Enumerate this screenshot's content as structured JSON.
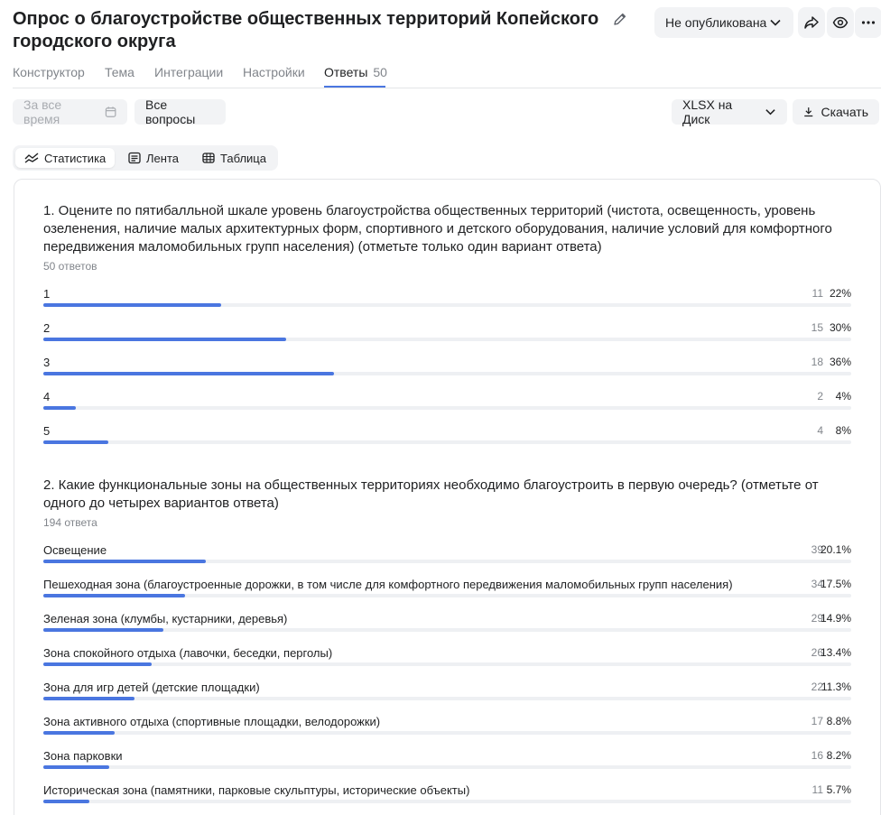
{
  "header": {
    "title": "Опрос о благоустройстве общественных территорий Копейского городского округа",
    "status": "Не опубликована"
  },
  "tabs": [
    {
      "label": "Конструктор"
    },
    {
      "label": "Тема"
    },
    {
      "label": "Интеграции"
    },
    {
      "label": "Настройки"
    },
    {
      "label": "Ответы",
      "count": "50"
    }
  ],
  "toolbar": {
    "date_filter": "За все время",
    "questions_filter": "Все вопросы",
    "export_target": "XLSX на Диск",
    "download": "Скачать"
  },
  "views": {
    "stats": "Статистика",
    "feed": "Лента",
    "table": "Таблица"
  },
  "questions": [
    {
      "title": "1. Оцените по пятибалльной шкале уровень благоустройства общественных территорий (чистота, освещенность, уровень озеленения, наличие малых архитектурных форм, спортивного и детского оборудования, наличие условий для комфортного передвижения маломобильных групп населения) (отметьте только один вариант ответа)",
      "answers": "50 ответов",
      "options": [
        {
          "label": "1",
          "count": "11",
          "pct": "22%",
          "fraction": 0.22
        },
        {
          "label": "2",
          "count": "15",
          "pct": "30%",
          "fraction": 0.3
        },
        {
          "label": "3",
          "count": "18",
          "pct": "36%",
          "fraction": 0.36
        },
        {
          "label": "4",
          "count": "2",
          "pct": "4%",
          "fraction": 0.04
        },
        {
          "label": "5",
          "count": "4",
          "pct": "8%",
          "fraction": 0.08
        }
      ]
    },
    {
      "title": "2. Какие функциональные зоны на общественных территориях необходимо благоустроить в первую очередь? (отметьте от одного до четырех вариантов ответа)",
      "answers": "194 ответа",
      "options": [
        {
          "label": "Освещение",
          "count": "39",
          "pct": "20.1%",
          "fraction": 0.201
        },
        {
          "label": "Пешеходная зона (благоустроенные дорожки, в том числе для комфортного передвижения маломобильных групп населения)",
          "count": "34",
          "pct": "17.5%",
          "fraction": 0.175
        },
        {
          "label": "Зеленая зона (клумбы, кустарники, деревья)",
          "count": "29",
          "pct": "14.9%",
          "fraction": 0.149
        },
        {
          "label": "Зона спокойного отдыха (лавочки, беседки, перголы)",
          "count": "26",
          "pct": "13.4%",
          "fraction": 0.134
        },
        {
          "label": "Зона для игр детей (детские площадки)",
          "count": "22",
          "pct": "11.3%",
          "fraction": 0.113
        },
        {
          "label": "Зона активного отдыха (спортивные площадки, велодорожки)",
          "count": "17",
          "pct": "8.8%",
          "fraction": 0.088
        },
        {
          "label": "Зона парковки",
          "count": "16",
          "pct": "8.2%",
          "fraction": 0.082
        },
        {
          "label": "Историческая зона (памятники, парковые скульптуры, исторические объекты)",
          "count": "11",
          "pct": "5.7%",
          "fraction": 0.057
        }
      ]
    }
  ],
  "colors": {
    "accent": "#4a76e0",
    "track": "#eef0f3",
    "muted": "#81858b"
  }
}
